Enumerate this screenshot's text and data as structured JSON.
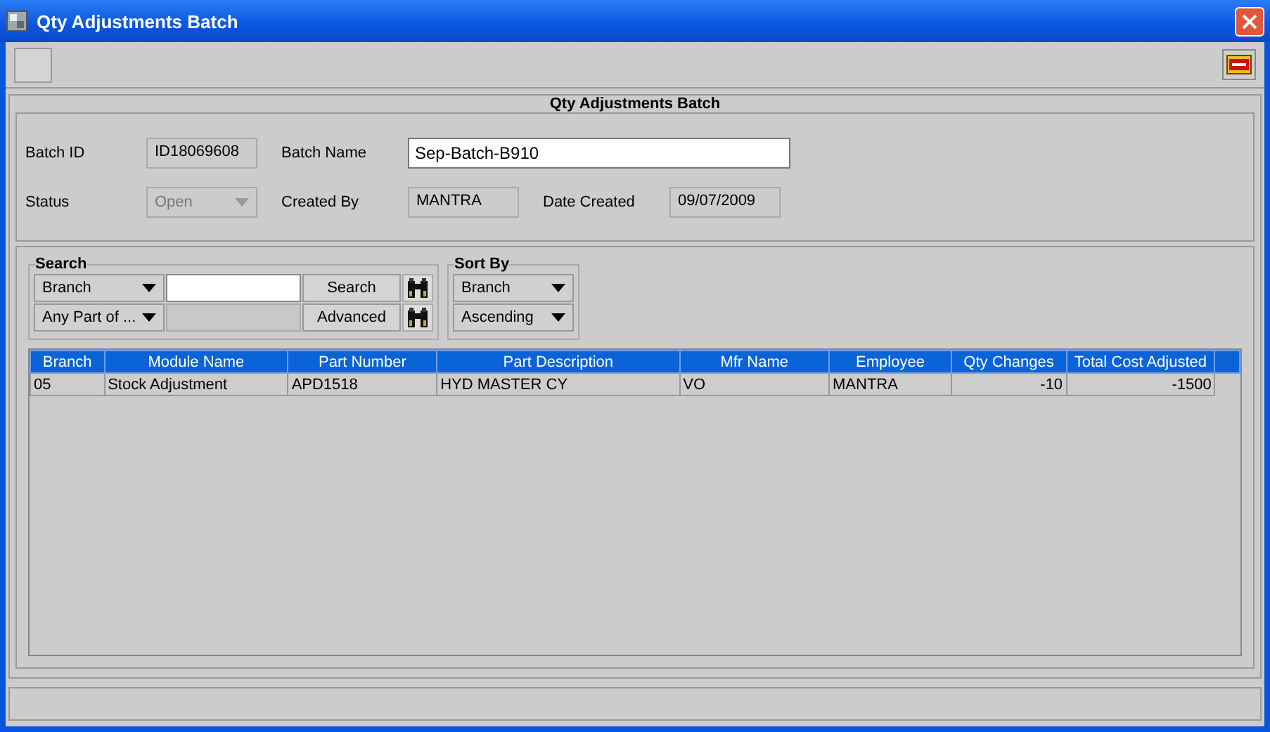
{
  "window": {
    "title": "Qty Adjustments Batch"
  },
  "batch_panel": {
    "title": "Qty Adjustments Batch",
    "fields": [
      {
        "label": "Batch ID",
        "kind": "readonly",
        "value": "ID18069608"
      },
      {
        "label": "Batch Name",
        "kind": "text",
        "value": "Sep-Batch-B910"
      },
      {
        "label": "Status",
        "kind": "dropdown",
        "value": "Open",
        "disabled": true
      },
      {
        "label": "Created By",
        "kind": "readonly",
        "value": "MANTRA"
      },
      {
        "label": "Date Created",
        "kind": "readonly",
        "value": "09/07/2009"
      }
    ]
  },
  "search": {
    "title": "Search",
    "field": "Branch",
    "match": "Any Part of ...",
    "buttons": [
      "Search",
      "Advanced"
    ]
  },
  "sort_by": {
    "title": "Sort By",
    "field": "Branch",
    "order": "Ascending"
  },
  "table": {
    "columns": [
      {
        "label": "Branch"
      },
      {
        "label": "Module Name"
      },
      {
        "label": "Part Number"
      },
      {
        "label": "Part Description"
      },
      {
        "label": "Mfr Name"
      },
      {
        "label": "Employee"
      },
      {
        "label": "Qty Changes"
      },
      {
        "label": "Total Cost Adjusted"
      }
    ],
    "rows": [
      [
        "05",
        "Stock Adjustment",
        "APD1518",
        "HYD MASTER CY",
        "VO",
        "MANTRA",
        "-10",
        "-1500"
      ]
    ]
  }
}
